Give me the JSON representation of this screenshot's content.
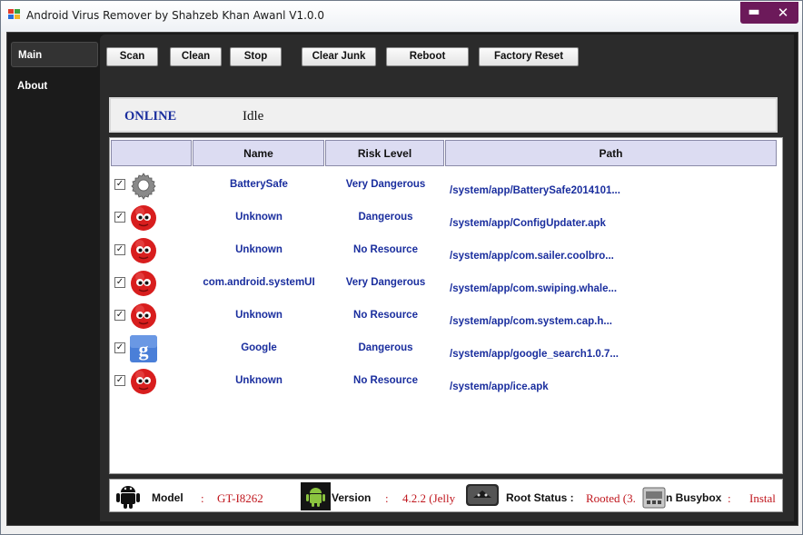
{
  "window": {
    "title": "Android Virus Remover by Shahzeb Khan Awanl V1.0.0",
    "minimize_glyph": "▬",
    "close_glyph": "✕"
  },
  "sidebar": {
    "items": [
      {
        "label": "Main",
        "active": true
      },
      {
        "label": "About",
        "active": false
      }
    ]
  },
  "toolbar": {
    "buttons": [
      "Scan",
      "Clean",
      "Stop",
      "Clear Junk",
      "Reboot",
      "Factory Reset"
    ]
  },
  "status": {
    "connection": "ONLINE",
    "state": "Idle"
  },
  "grid": {
    "columns": [
      "",
      "Name",
      "Risk Level",
      "Path"
    ],
    "rows": [
      {
        "checked": true,
        "icon": "gear-icon",
        "name": "BatterySafe",
        "risk": "Very Dangerous",
        "path": "/system/app/BatterySafe2014101..."
      },
      {
        "checked": true,
        "icon": "red-virus-icon",
        "name": "Unknown",
        "risk": "Dangerous",
        "path": "/system/app/ConfigUpdater.apk"
      },
      {
        "checked": true,
        "icon": "red-virus-icon",
        "name": "Unknown",
        "risk": "No Resource",
        "path": "/system/app/com.sailer.coolbro..."
      },
      {
        "checked": true,
        "icon": "red-virus-icon",
        "name": "com.android.systemUI",
        "risk": "Very Dangerous",
        "path": "/system/app/com.swiping.whale..."
      },
      {
        "checked": true,
        "icon": "red-virus-icon",
        "name": "Unknown",
        "risk": "No Resource",
        "path": "/system/app/com.system.cap.h..."
      },
      {
        "checked": true,
        "icon": "google-icon",
        "name": "Google",
        "risk": "Dangerous",
        "path": "/system/app/google_search1.0.7..."
      },
      {
        "checked": true,
        "icon": "red-virus-icon",
        "name": "Unknown",
        "risk": "No Resource",
        "path": "/system/app/ice.apk"
      }
    ]
  },
  "device": {
    "model_label": "Model",
    "model_sep": ":",
    "model_value": "GT-I8262",
    "version_label": "Version",
    "version_sep": ":",
    "version_value": "4.2.2 (Jelly",
    "root_label": "Root Status :",
    "root_value": "Rooted (3.",
    "busybox_label": "n Busybox",
    "busybox_sep": ":",
    "busybox_value": "Instal"
  },
  "colors": {
    "accent_text": "#1a2e9e",
    "value_red": "#c0161d",
    "window_buttons": "#6c1a5a",
    "dark_frame": "#1b1b1b"
  }
}
